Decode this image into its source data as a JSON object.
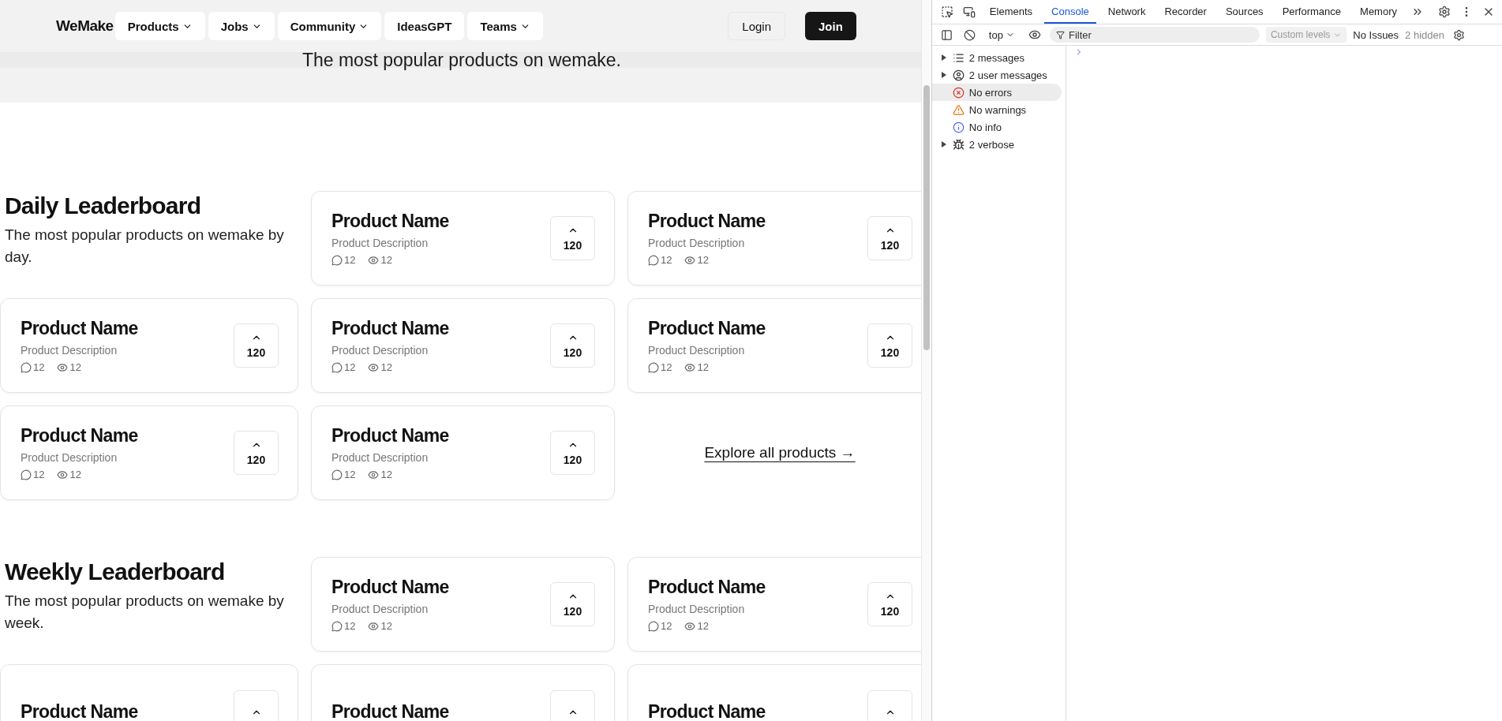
{
  "header": {
    "logo": "WeMake",
    "nav": [
      {
        "label": "Products",
        "dropdown": true
      },
      {
        "label": "Jobs",
        "dropdown": true
      },
      {
        "label": "Community",
        "dropdown": true
      },
      {
        "label": "IdeasGPT",
        "dropdown": false
      },
      {
        "label": "Teams",
        "dropdown": true
      }
    ],
    "login": "Login",
    "join": "Join"
  },
  "hero": {
    "subtitle": "The most popular products on wemake."
  },
  "sections": [
    {
      "title": "Daily Leaderboard",
      "description": "The most popular products on wemake by day.",
      "items": [
        {
          "kind": "product",
          "name": "Product Name",
          "description": "Product Description",
          "comments": "12",
          "views": "12",
          "upvotes": "120"
        },
        {
          "kind": "product",
          "name": "Product Name",
          "description": "Product Description",
          "comments": "12",
          "views": "12",
          "upvotes": "120"
        },
        {
          "kind": "product",
          "name": "Product Name",
          "description": "Product Description",
          "comments": "12",
          "views": "12",
          "upvotes": "120"
        },
        {
          "kind": "product",
          "name": "Product Name",
          "description": "Product Description",
          "comments": "12",
          "views": "12",
          "upvotes": "120"
        },
        {
          "kind": "product",
          "name": "Product Name",
          "description": "Product Description",
          "comments": "12",
          "views": "12",
          "upvotes": "120"
        },
        {
          "kind": "product",
          "name": "Product Name",
          "description": "Product Description",
          "comments": "12",
          "views": "12",
          "upvotes": "120"
        },
        {
          "kind": "product",
          "name": "Product Name",
          "description": "Product Description",
          "comments": "12",
          "views": "12",
          "upvotes": "120"
        },
        {
          "kind": "link",
          "label": "Explore all products →"
        }
      ]
    },
    {
      "title": "Weekly Leaderboard",
      "description": "The most popular products on wemake by week.",
      "items": [
        {
          "kind": "product",
          "name": "Product Name",
          "description": "Product Description",
          "comments": "12",
          "views": "12",
          "upvotes": "120"
        },
        {
          "kind": "product",
          "name": "Product Name",
          "description": "Product Description",
          "comments": "12",
          "views": "12",
          "upvotes": "120"
        },
        {
          "kind": "product",
          "name": "Product Name"
        },
        {
          "kind": "product",
          "name": "Product Name"
        },
        {
          "kind": "product",
          "name": "Product Name"
        }
      ]
    }
  ],
  "devtools": {
    "tabs": [
      {
        "label": "Elements",
        "selected": false
      },
      {
        "label": "Console",
        "selected": true
      },
      {
        "label": "Network",
        "selected": false
      },
      {
        "label": "Recorder",
        "selected": false
      },
      {
        "label": "Sources",
        "selected": false
      },
      {
        "label": "Performance",
        "selected": false
      },
      {
        "label": "Memory",
        "selected": false
      }
    ],
    "context": "top",
    "filter_placeholder": "Filter",
    "levels": "Custom levels",
    "issues": "No Issues",
    "hidden": "2 hidden",
    "sidebar": [
      {
        "label": "2 messages",
        "kind": "list",
        "expandable": true,
        "selected": false
      },
      {
        "label": "2 user messages",
        "kind": "user",
        "expandable": true,
        "selected": false
      },
      {
        "label": "No errors",
        "kind": "error",
        "expandable": false,
        "selected": true
      },
      {
        "label": "No warnings",
        "kind": "warning",
        "expandable": false,
        "selected": false
      },
      {
        "label": "No info",
        "kind": "info",
        "expandable": false,
        "selected": false
      },
      {
        "label": "2 verbose",
        "kind": "verbose",
        "expandable": true,
        "selected": false
      }
    ]
  }
}
